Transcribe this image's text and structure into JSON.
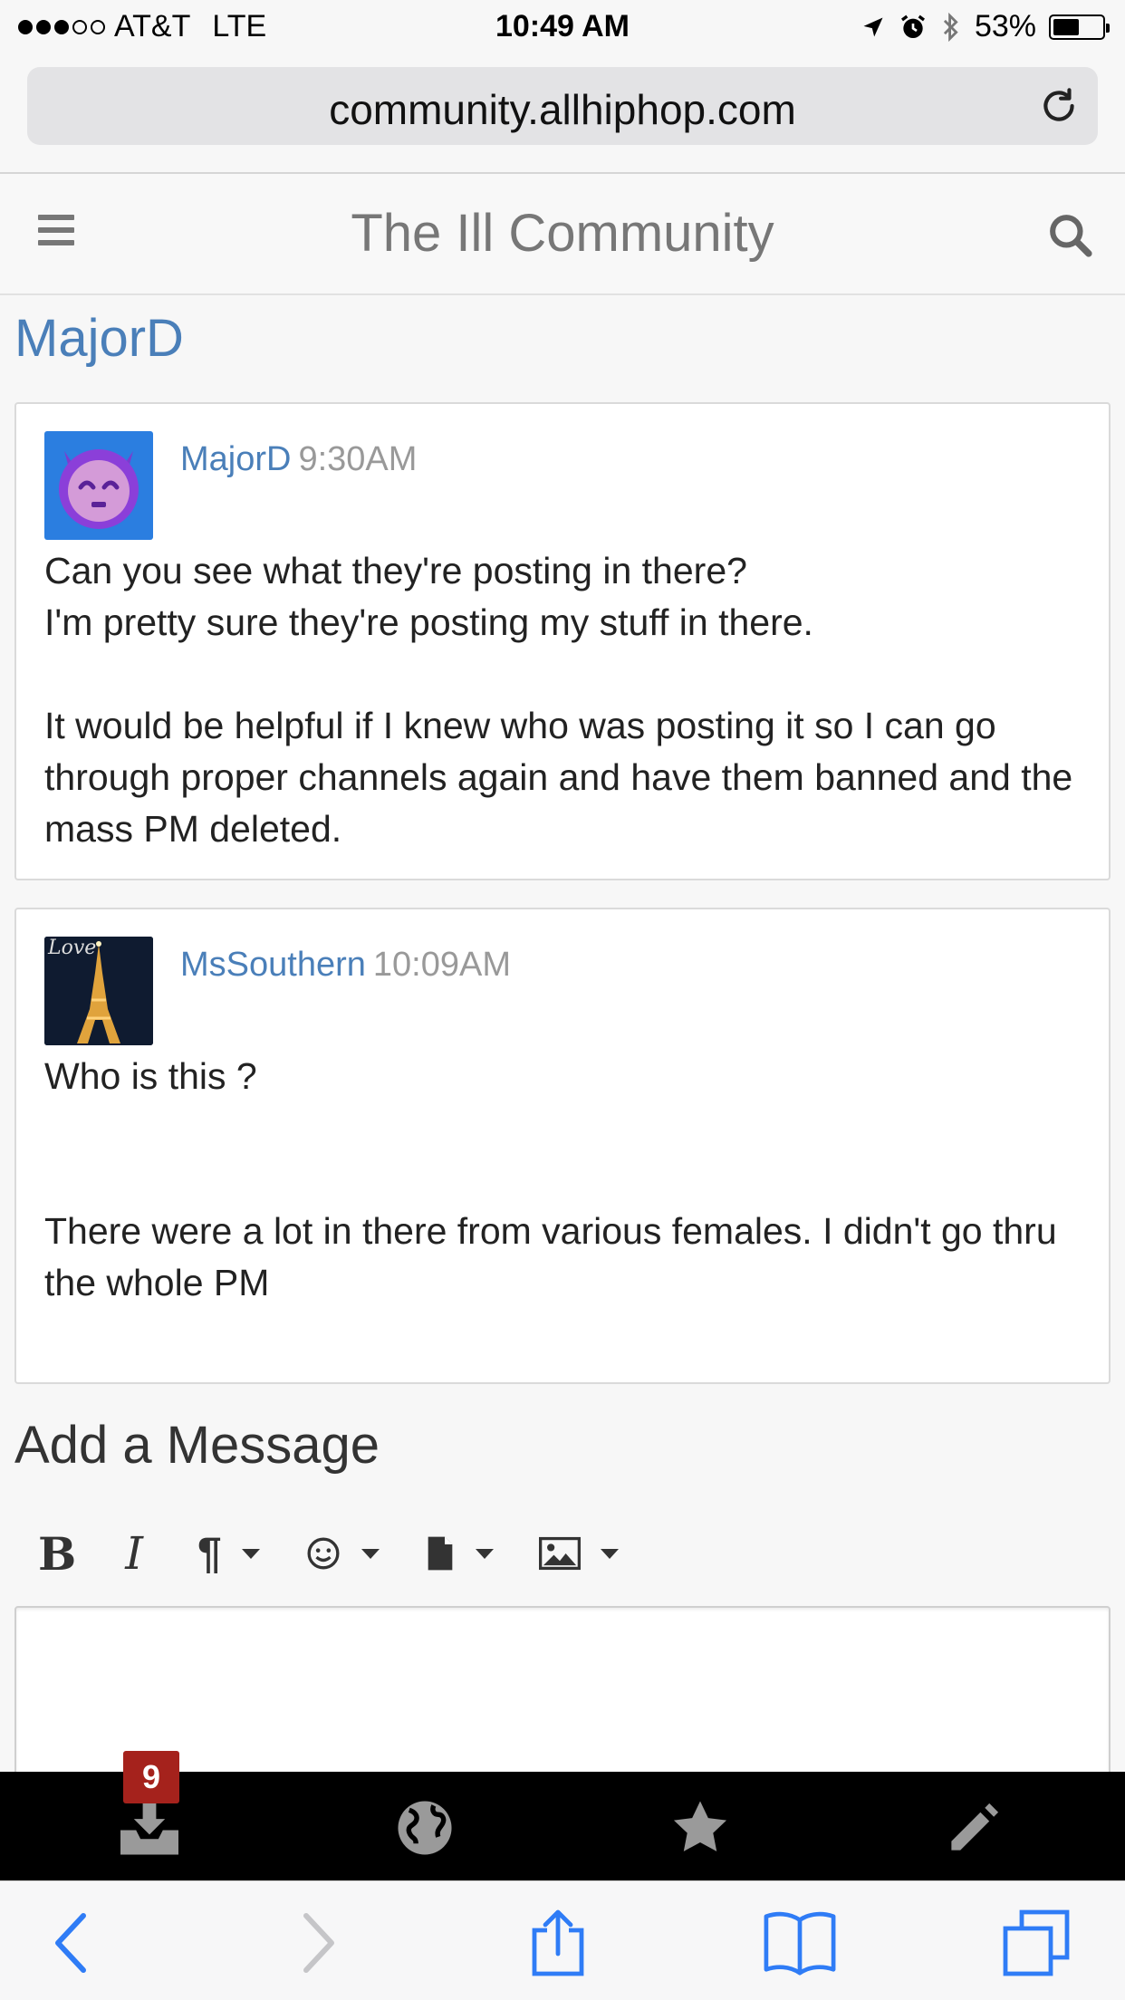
{
  "status_bar": {
    "carrier": "AT&T",
    "network": "LTE",
    "time": "10:49 AM",
    "battery_percent": "53%",
    "battery_level": 0.53,
    "signal_bars": 3
  },
  "browser": {
    "url": "community.allhiphop.com",
    "reload_icon": "reload-icon"
  },
  "header": {
    "title": "The Ill Community",
    "menu_icon": "hamburger-menu-icon",
    "search_icon": "search-icon"
  },
  "profile": {
    "name": "MajorD"
  },
  "posts": [
    {
      "author": "MajorD",
      "time": "9:30AM",
      "body": "Can you see what they're posting in there?\nI'm pretty sure they're posting my stuff in there.\n\nIt would be helpful if I knew who was posting it so I can go through proper channels again and have them banned and the mass PM deleted."
    },
    {
      "author": "MsSouthern",
      "time": "10:09AM",
      "avatar_text": "Love",
      "body": "Who is this ?\n\n\nThere were a lot in there from various females. I didn't go thru the whole PM"
    }
  ],
  "composer": {
    "title": "Add a Message",
    "toolbar": {
      "bold": "B",
      "italic": "I",
      "paragraph": "¶"
    }
  },
  "app_nav": {
    "inbox_badge": "9",
    "items": [
      "inbox-icon",
      "globe-icon",
      "star-icon",
      "pencil-icon"
    ]
  },
  "colors": {
    "link": "#4a7fb9",
    "badge": "#a5221c",
    "nav_bg": "#000000",
    "safari_blue": "#2f7cf6"
  }
}
